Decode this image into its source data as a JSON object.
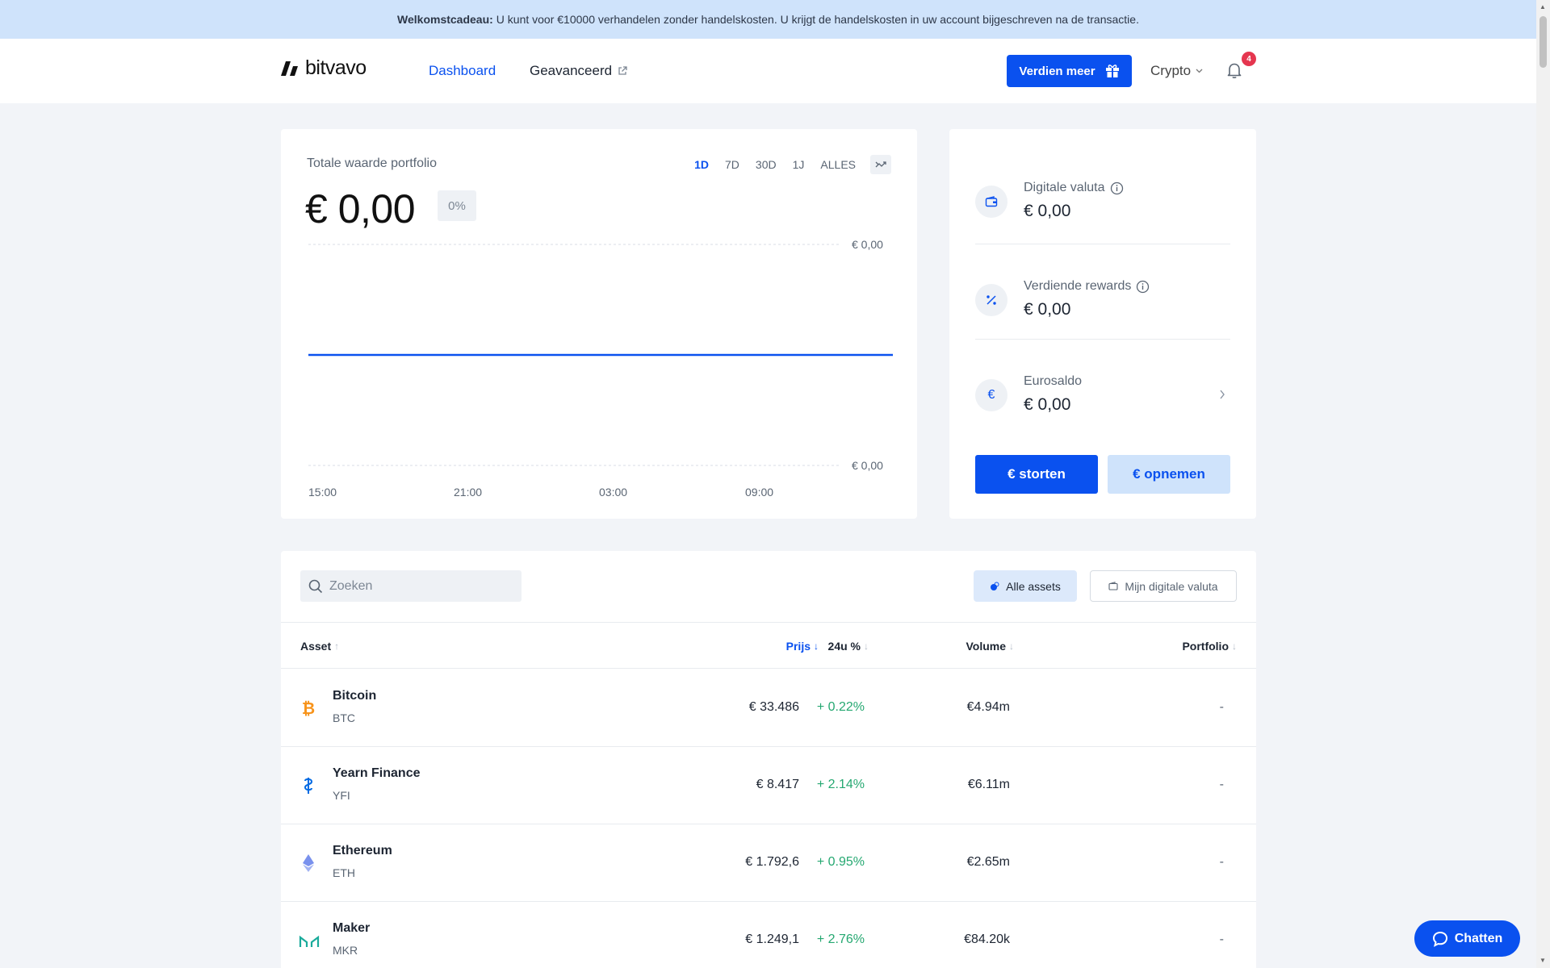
{
  "promo": {
    "bold": "Welkomstcadeau:",
    "text": "U kunt voor €10000 verhandelen zonder handelskosten. U krijgt de handelskosten in uw account bijgeschreven na de transactie."
  },
  "header": {
    "logo_text": "bitvavo",
    "nav": {
      "dashboard": "Dashboard",
      "advanced": "Geavanceerd"
    },
    "earn_label": "Verdien meer",
    "crypto_label": "Crypto",
    "notification_count": "4"
  },
  "portfolio": {
    "title": "Totale waarde portfolio",
    "value": "€ 0,00",
    "change": "0%",
    "ranges": [
      "1D",
      "7D",
      "30D",
      "1J",
      "ALLES"
    ],
    "active_range": "1D"
  },
  "chart_data": {
    "type": "line",
    "x": [
      "15:00",
      "21:00",
      "03:00",
      "09:00"
    ],
    "y_tick_labels": [
      "€ 0,00",
      "€ 0,00"
    ],
    "series": [
      {
        "values": [
          0,
          0,
          0,
          0
        ]
      }
    ],
    "grid": true,
    "line_color": "#0a51ef"
  },
  "summary": {
    "digital_label": "Digitale valuta",
    "digital_value": "€ 0,00",
    "rewards_label": "Verdiende rewards",
    "rewards_value": "€ 0,00",
    "euro_label": "Eurosaldo",
    "euro_value": "€ 0,00",
    "euro_icon": "€",
    "deposit_label": "€ storten",
    "withdraw_label": "€ opnemen"
  },
  "assets": {
    "search_placeholder": "Zoeken",
    "filter_all": "Alle assets",
    "filter_mine": "Mijn digitale valuta",
    "columns": {
      "asset": "Asset",
      "price": "Prijs",
      "change": "24u %",
      "volume": "Volume",
      "portfolio": "Portfolio"
    },
    "rows": [
      {
        "name": "Bitcoin",
        "symbol": "BTC",
        "price": "€ 33.486",
        "change": "+ 0.22%",
        "volume": "€4.94m",
        "portfolio": "-",
        "icon": "bitcoin-icon",
        "color": "#f7931a"
      },
      {
        "name": "Yearn Finance",
        "symbol": "YFI",
        "price": "€ 8.417",
        "change": "+ 2.14%",
        "volume": "€6.11m",
        "portfolio": "-",
        "icon": "yearn-icon",
        "color": "#006ae3"
      },
      {
        "name": "Ethereum",
        "symbol": "ETH",
        "price": "€ 1.792,6",
        "change": "+ 0.95%",
        "volume": "€2.65m",
        "portfolio": "-",
        "icon": "ethereum-icon",
        "color": "#627eea"
      },
      {
        "name": "Maker",
        "symbol": "MKR",
        "price": "€ 1.249,1",
        "change": "+ 2.76%",
        "volume": "€84.20k",
        "portfolio": "-",
        "icon": "maker-icon",
        "color": "#1aab9b"
      }
    ]
  },
  "chat": {
    "label": "Chatten"
  }
}
